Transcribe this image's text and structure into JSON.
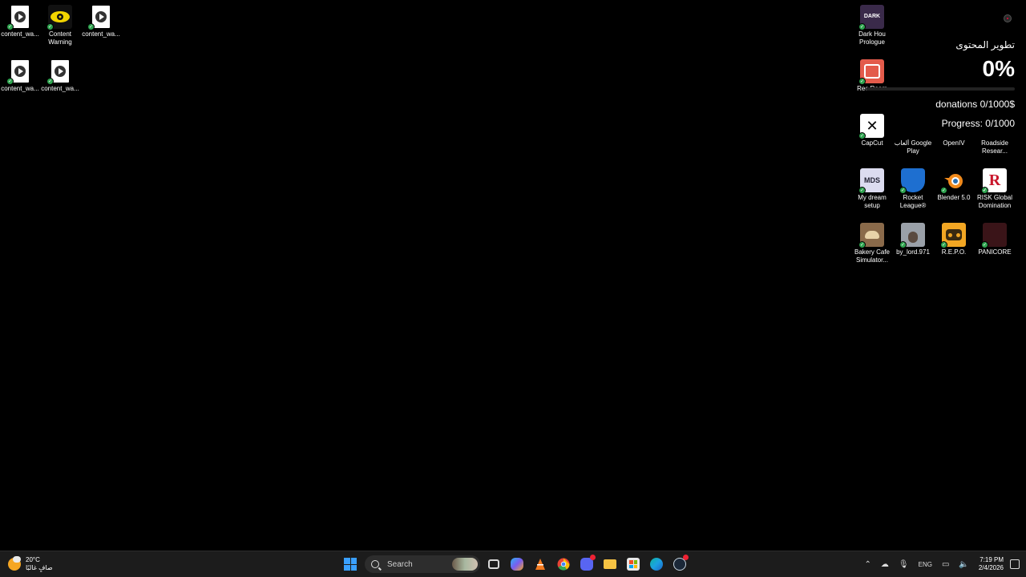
{
  "desktop_left": [
    {
      "label": "content_wa...",
      "kind": "video"
    },
    {
      "label": "Content Warning",
      "kind": "app"
    },
    {
      "label": "content_wa...",
      "kind": "video"
    },
    {
      "label": "content_wa...",
      "kind": "video"
    },
    {
      "label": "content_wa...",
      "kind": "video"
    }
  ],
  "desktop_right": [
    {
      "label": "Dark Hou Prologue",
      "color": "#3a2a4a"
    },
    {
      "label": "Rec Room",
      "color": "#e35b4b"
    },
    {
      "label": "CapCut",
      "color": "#ffffff"
    },
    {
      "label": "ألعاب Google Play",
      "color": "#000000"
    },
    {
      "label": "OpenIV",
      "color": "#000000"
    },
    {
      "label": "Roadside Resear...",
      "color": "#000000"
    },
    {
      "label": "My dream setup",
      "color": "#dcdcf0"
    },
    {
      "label": "Rocket League®",
      "color": "#1e6fd0"
    },
    {
      "label": "Blender 5.0",
      "color": "#f08a1c"
    },
    {
      "label": "RISK Global Domination",
      "color": "#c9162b"
    },
    {
      "label": "Bakery Cafe Simulator...",
      "color": "#8a6a4a"
    },
    {
      "label": "by_lord.971",
      "color": "#9aa0a8"
    },
    {
      "label": "R.E.P.O.",
      "color": "#f2a623"
    },
    {
      "label": "PANICORE",
      "color": "#3a1418"
    }
  ],
  "widget": {
    "title": "تطوير المحتوى",
    "percent": "0%",
    "progress_fraction": 0,
    "donations": "donations 0/1000$",
    "progress": "Progress: 0/1000"
  },
  "taskbar": {
    "weather_temp": "20°C",
    "weather_desc": "صافٍ غالبًا",
    "search_placeholder": "Search",
    "apps": [
      {
        "name": "task-view",
        "color": "#d8d8d8"
      },
      {
        "name": "copilot",
        "color": "#7a5cf0"
      },
      {
        "name": "vlc",
        "color": "#f47a1f"
      },
      {
        "name": "chrome",
        "color": "#34a853"
      },
      {
        "name": "discord",
        "color": "#5865f2"
      },
      {
        "name": "file-explorer",
        "color": "#f6c343"
      },
      {
        "name": "microsoft-store",
        "color": "#e8e8e8"
      },
      {
        "name": "edge",
        "color": "#1ba1e2"
      },
      {
        "name": "steam",
        "color": "#c7d5e0"
      }
    ],
    "lang": "ENG",
    "time": "7:19 PM",
    "date": "2/4/2026"
  }
}
